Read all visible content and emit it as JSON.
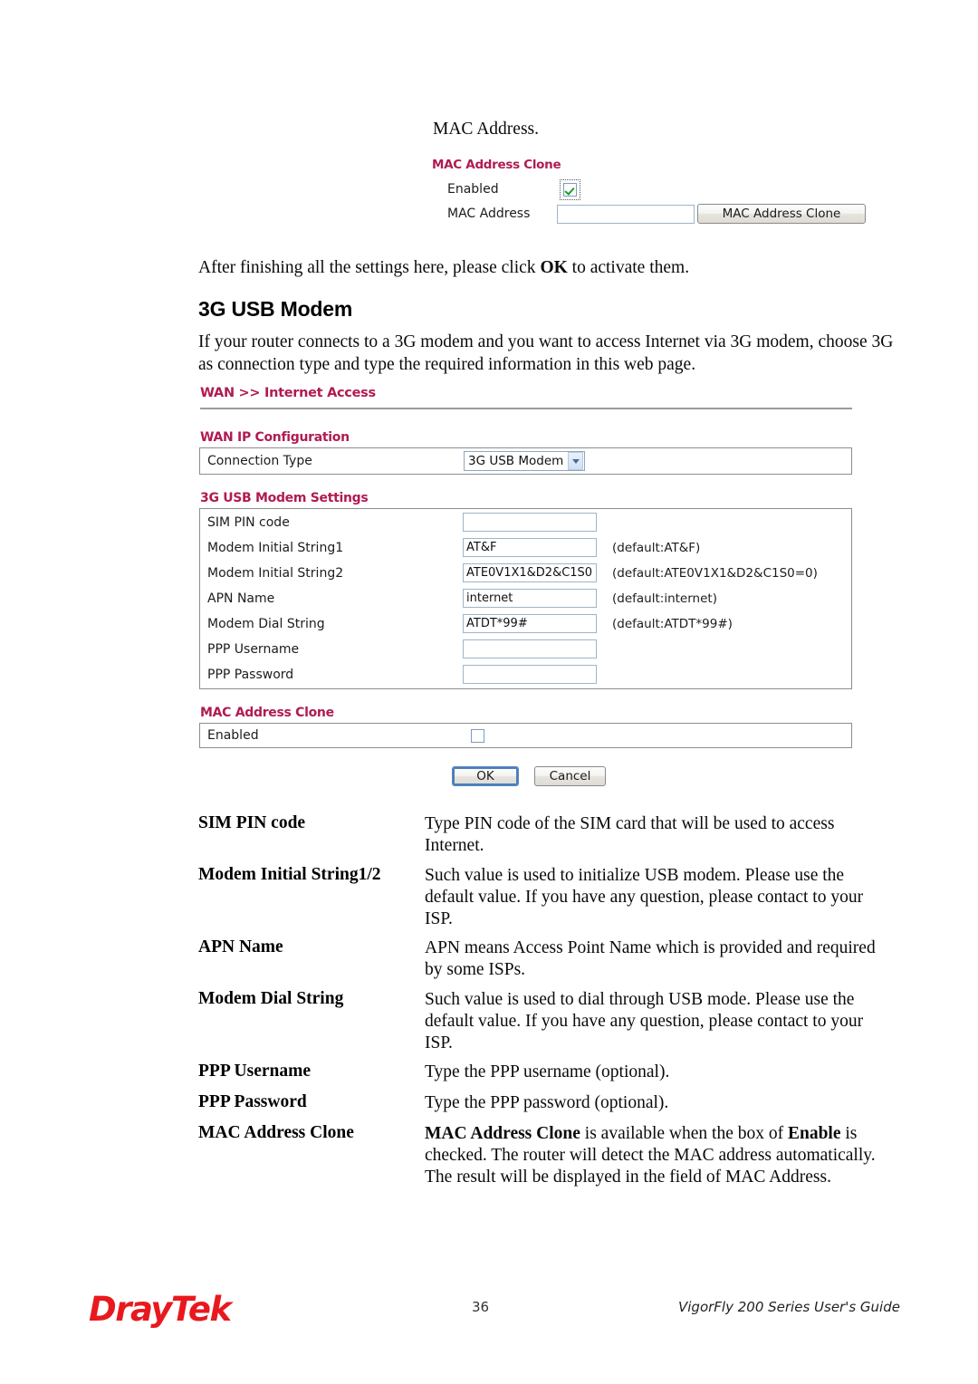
{
  "page": {
    "number": "36",
    "guide_title": "VigorFly 200 Series User's Guide",
    "brand": "DrayTek"
  },
  "top_continuation": {
    "text": "MAC Address."
  },
  "top_panel": {
    "section_title": "MAC Address Clone",
    "enabled_label": "Enabled",
    "enabled_checked": true,
    "mac_address_label": "MAC Address",
    "mac_address_value": "",
    "clone_button_label": "MAC Address Clone"
  },
  "after_settings_paragraph": {
    "before": "After finishing all the settings here, please click ",
    "bold": "OK",
    "after": " to activate them."
  },
  "heading": {
    "text": "3G USB Modem"
  },
  "intro_paragraph": {
    "text": "If your router connects to a 3G modem and you want to access Internet via 3G modem, choose 3G as connection type and type the required information in this web page."
  },
  "router_ui": {
    "breadcrumb": "WAN >> Internet Access",
    "wan_ip_config": {
      "section_title": "WAN IP Configuration",
      "connection_type_label": "Connection Type",
      "connection_type_value": "3G USB Modem",
      "connection_type_options": [
        "3G USB Modem"
      ]
    },
    "modem_settings": {
      "section_title": "3G USB Modem Settings",
      "rows": [
        {
          "label": "SIM PIN code",
          "value": "",
          "note": ""
        },
        {
          "label": "Modem Initial String1",
          "value": "AT&F",
          "note": "(default:AT&F)"
        },
        {
          "label": "Modem Initial String2",
          "value": "ATE0V1X1&D2&C1S0",
          "note": "(default:ATE0V1X1&D2&C1S0=0)"
        },
        {
          "label": "APN Name",
          "value": "internet",
          "note": "(default:internet)"
        },
        {
          "label": "Modem Dial String",
          "value": "ATDT*99#",
          "note": "(default:ATDT*99#)"
        },
        {
          "label": "PPP Username",
          "value": "",
          "note": ""
        },
        {
          "label": "PPP Password",
          "value": "",
          "note": ""
        }
      ]
    },
    "mac_clone": {
      "section_title": "MAC Address Clone",
      "enabled_label": "Enabled",
      "enabled_checked": false
    },
    "actions": {
      "ok_label": "OK",
      "cancel_label": "Cancel"
    }
  },
  "descriptions": [
    {
      "term": "SIM PIN code",
      "def": "Type PIN code of the SIM card that will be used to access Internet."
    },
    {
      "term": "Modem Initial String1/2",
      "def": "Such value is used to initialize USB modem. Please use the default value. If you have any question, please contact to your ISP."
    },
    {
      "term": "APN Name",
      "def": "APN means Access Point Name which is provided and required by some ISPs."
    },
    {
      "term": "Modem Dial String",
      "def": "Such value is used to dial through USB mode. Please use the default value. If you have any question, please contact to your ISP."
    },
    {
      "term": "PPP Username",
      "def": "Type the PPP username (optional)."
    },
    {
      "term": "PPP Password",
      "def": "Type the PPP password (optional)."
    },
    {
      "term": "MAC Address Clone",
      "def_parts": {
        "b1": "MAC Address Clone",
        "t1": " is available when the box of ",
        "b2": "Enable",
        "t2": " is checked. The router will detect the MAC address automatically. The result will be displayed in the field of MAC Address."
      }
    }
  ],
  "colors": {
    "section_pink": "#b01b52",
    "brand_red": "#e8191e",
    "input_border": "#9db5cd",
    "panel_border": "#8d8d8d"
  }
}
